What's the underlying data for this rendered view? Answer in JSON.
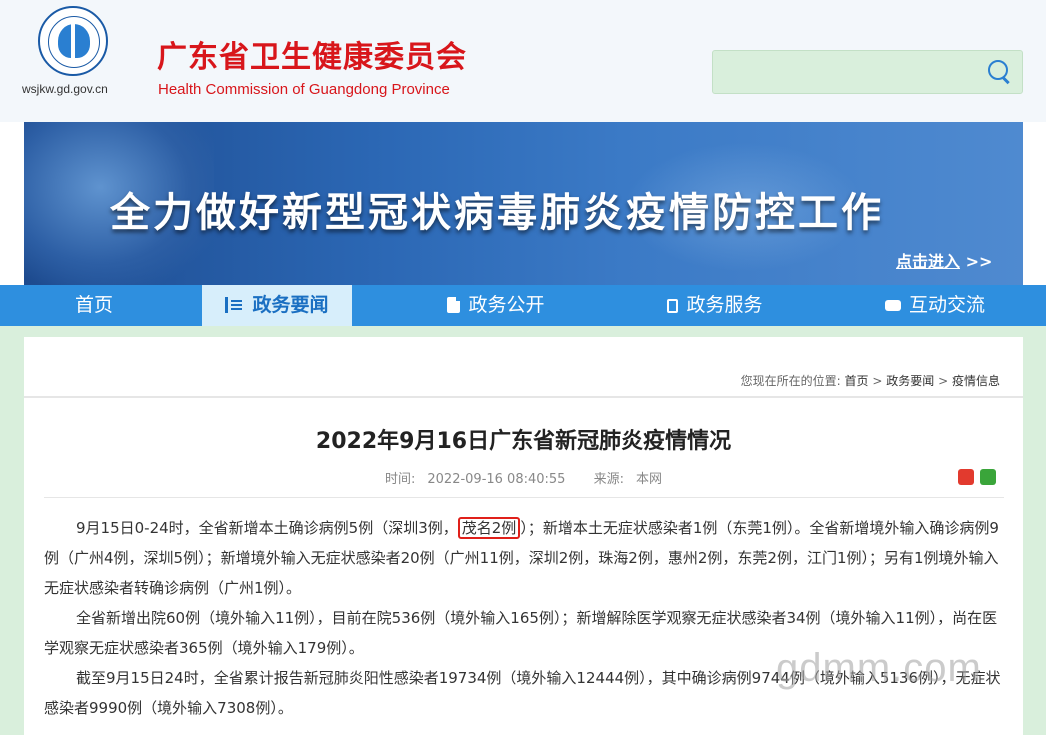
{
  "header": {
    "site_url": "wsjkw.gd.gov.cn",
    "title_cn": "广东省卫生健康委员会",
    "title_en": "Health Commission of Guangdong Province",
    "search_placeholder": "",
    "search_icon": "search-icon"
  },
  "banner": {
    "title": "全力做好新型冠状病毒肺炎疫情防控工作",
    "link_label": "点击进入",
    "link_suffix": ">>"
  },
  "nav": {
    "items": [
      {
        "label": "首页",
        "icon": ""
      },
      {
        "label": "政务要闻",
        "icon": "list-icon",
        "active": true
      },
      {
        "label": "政务公开",
        "icon": "document-icon"
      },
      {
        "label": "政务服务",
        "icon": "clipboard-icon"
      },
      {
        "label": "互动交流",
        "icon": "chat-icon"
      }
    ]
  },
  "breadcrumb": {
    "prefix": "您现在所在的位置:",
    "items": [
      "首页",
      "政务要闻",
      "疫情信息"
    ],
    "separator": ">"
  },
  "article": {
    "title": "2022年9月16日广东省新冠肺炎疫情情况",
    "time_label": "时间:",
    "time_value": "2022-09-16 08:40:55",
    "source_label": "来源:",
    "source_value": "本网",
    "p1_a": "9月15日0-24时，全省新增本土确诊病例5例（深圳3例，",
    "p1_hl": "茂名2例",
    "p1_b": "）；新增本土无症状感染者1例（东莞1例）。全省新增境外输入确诊病例9例（广州4例，深圳5例）；新增境外输入无症状感染者20例（广州11例，深圳2例，珠海2例，惠州2例，东莞2例，江门1例）；另有1例境外输入无症状感染者转确诊病例（广州1例）。",
    "p2": "全省新增出院60例（境外输入11例），目前在院536例（境外输入165例）；新增解除医学观察无症状感染者34例（境外输入11例），尚在医学观察无症状感染者365例（境外输入179例）。",
    "p3": "截至9月15日24时，全省累计报告新冠肺炎阳性感染者19734例（境外输入12444例），其中确诊病例9744例（境外输入5136例），无症状感染者9990例（境外输入7308例）。"
  },
  "watermark": "gdmm.com",
  "colors": {
    "brand_red": "#d8161b",
    "nav_blue": "#2e8fdf",
    "page_green": "#d9efdc",
    "highlight_red": "#e0201a"
  }
}
